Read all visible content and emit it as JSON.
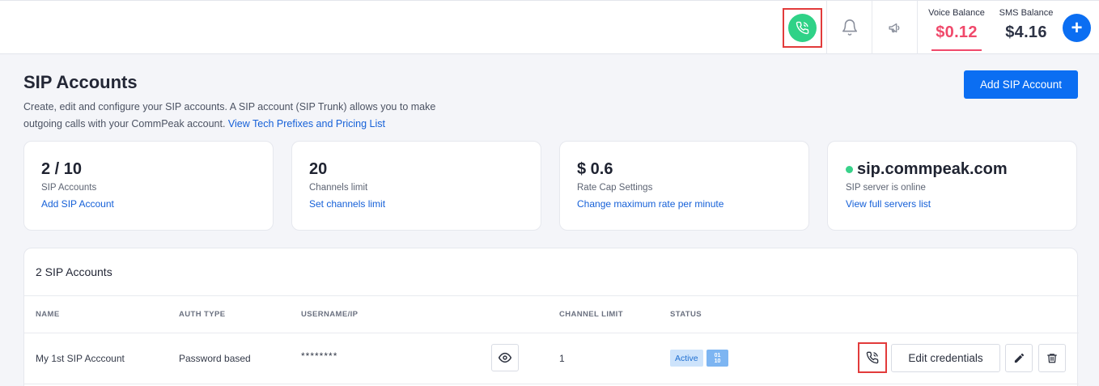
{
  "topbar": {
    "icons": {
      "call": "phone-call-icon",
      "notifications": "bell-icon",
      "announcements": "megaphone-icon",
      "add": "plus-icon"
    },
    "voice_balance": {
      "label": "Voice Balance",
      "value": "$0.12"
    },
    "sms_balance": {
      "label": "SMS Balance",
      "value": "$4.16"
    },
    "plus_label": "+"
  },
  "header": {
    "title": "SIP Accounts",
    "description": "Create, edit and configure your SIP accounts. A SIP account (SIP Trunk) allows you to make outgoing calls with your CommPeak account.",
    "description_link": "View Tech Prefixes and Pricing List",
    "add_button": "Add SIP Account"
  },
  "stats": [
    {
      "value": "2 / 10",
      "label": "SIP Accounts",
      "link": "Add SIP Account"
    },
    {
      "value": "20",
      "label": "Channels limit",
      "link": "Set channels limit"
    },
    {
      "value": "$ 0.6",
      "label": "Rate Cap Settings",
      "link": "Change maximum rate per minute"
    },
    {
      "value": "sip.commpeak.com",
      "label": "SIP server is online",
      "link": "View full servers list",
      "status_color": "#38d28a"
    }
  ],
  "table": {
    "title": "2 SIP Accounts",
    "columns": [
      "NAME",
      "AUTH TYPE",
      "USERNAME/IP",
      "CHANNEL LIMIT",
      "STATUS"
    ],
    "rows": [
      {
        "name": "My 1st SIP Acccount",
        "auth_type": "Password based",
        "username": "********",
        "channel_limit": "1",
        "status": "Active",
        "status_code": "01\n10",
        "edit_credentials": "Edit credentials"
      }
    ]
  },
  "colors": {
    "accent": "#0b6ef2",
    "call_green": "#2fd287",
    "voice_balance": "#f0496b",
    "highlight": "#e23b3b"
  }
}
